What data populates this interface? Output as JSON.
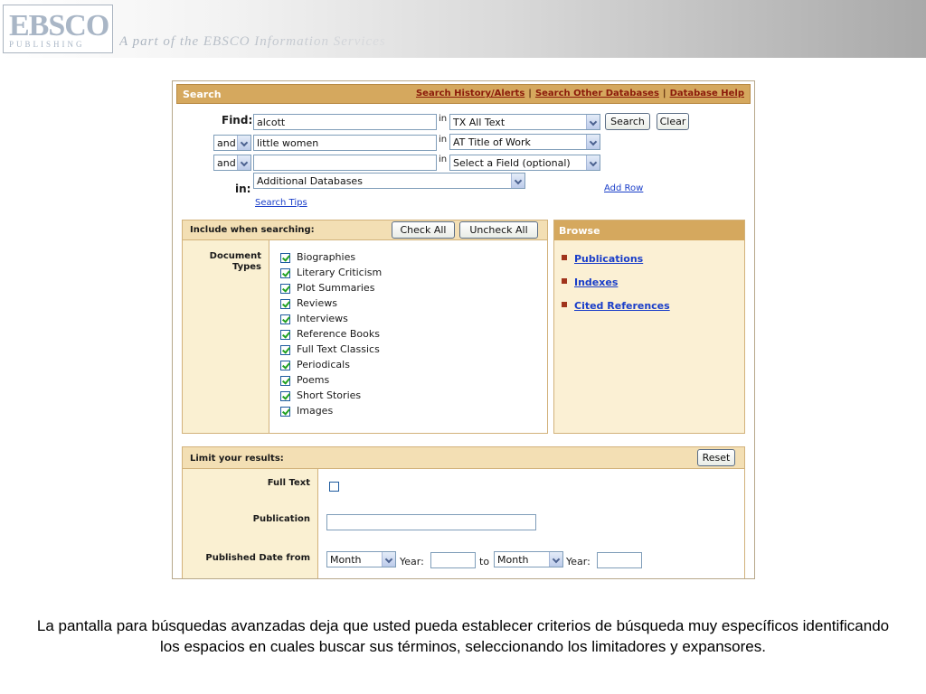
{
  "brand": {
    "logo_text": "EBSCO",
    "logo_sub": "PUBLISHING",
    "tagline": "A part of the EBSCO Information Services"
  },
  "search": {
    "title": "Search",
    "links": [
      "Search History/Alerts",
      "Search Other Databases",
      "Database Help"
    ],
    "find_label": "Find:",
    "in_word": "in",
    "rows": [
      {
        "term": "alcott",
        "field": "TX All Text"
      },
      {
        "bool": "and",
        "term": "little women",
        "field": "AT Title of Work"
      },
      {
        "bool": "and",
        "term": "",
        "field": "Select a Field (optional)"
      }
    ],
    "search_button": "Search",
    "clear_button": "Clear",
    "in_label": "in:",
    "database": "Additional Databases",
    "add_row": "Add Row",
    "search_tips": "Search Tips"
  },
  "include": {
    "title": "Include when searching:",
    "check_all": "Check All",
    "uncheck_all": "Uncheck All",
    "doc_types_label": "Document Types",
    "items": [
      {
        "label": "Biographies",
        "checked": true
      },
      {
        "label": "Literary Criticism",
        "checked": true
      },
      {
        "label": "Plot Summaries",
        "checked": true
      },
      {
        "label": "Reviews",
        "checked": true
      },
      {
        "label": "Interviews",
        "checked": true
      },
      {
        "label": "Reference Books",
        "checked": true
      },
      {
        "label": "Full Text Classics",
        "checked": true
      },
      {
        "label": "Periodicals",
        "checked": true
      },
      {
        "label": "Poems",
        "checked": true
      },
      {
        "label": "Short Stories",
        "checked": true
      },
      {
        "label": "Images",
        "checked": true
      }
    ]
  },
  "browse": {
    "title": "Browse",
    "items": [
      "Publications",
      "Indexes",
      "Cited References"
    ]
  },
  "limit": {
    "title": "Limit your results:",
    "reset": "Reset",
    "full_text_label": "Full Text",
    "full_text_checked": false,
    "publication_label": "Publication",
    "publication_value": "",
    "date_label": "Published Date from",
    "month_from": "Month",
    "year_label": "Year:",
    "year_from": "",
    "to_word": "to",
    "month_to": "Month",
    "year_to": ""
  },
  "caption": "La pantalla para búsquedas avanzadas deja que usted pueda establecer criterios de búsqueda muy específicos identificando los espacios en cuales buscar sus términos, seleccionando los limitadores y expansores.",
  "colors": {
    "accent_bar": "#d5a85e",
    "panel_light": "#f3dfb4",
    "side_fill": "#faf0d2",
    "link": "#1a3ec9",
    "header_link": "#8b1a0a",
    "bullet": "#a0341c"
  }
}
